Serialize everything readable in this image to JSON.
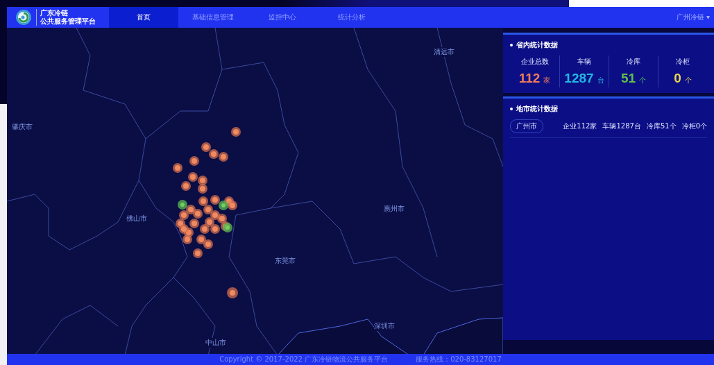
{
  "header": {
    "logo_line_1": "广东冷链",
    "logo_line_2": "公共服务管理平台",
    "nav": [
      {
        "label": "首页",
        "selected": true
      },
      {
        "label": "基础信息管理",
        "selected": false
      },
      {
        "label": "监控中心",
        "selected": false
      },
      {
        "label": "统计分析",
        "selected": false
      }
    ],
    "user": "广州冷链 ▾"
  },
  "map": {
    "labels": [
      "清远市",
      "肇庆市",
      "佛山市",
      "惠州市",
      "东莞市",
      "深圳市",
      "中山市"
    ]
  },
  "province_stats": {
    "title": "省内统计数据",
    "items": [
      {
        "label": "企业总数",
        "value": "112",
        "unit": "家",
        "color": "#f07a5a"
      },
      {
        "label": "车辆",
        "value": "1287",
        "unit": "台",
        "color": "#22b8e0"
      },
      {
        "label": "冷库",
        "value": "51",
        "unit": "个",
        "color": "#5cc04a"
      },
      {
        "label": "冷柜",
        "value": "0",
        "unit": "个",
        "color": "#e8d650"
      }
    ]
  },
  "city_stats": {
    "title": "地市统计数据",
    "rows": [
      {
        "city": "广州市",
        "cells": [
          "企业112家",
          "车辆1287台",
          "冷库51个",
          "冷柜0个"
        ]
      }
    ]
  },
  "footer": {
    "copyright": "Copyright © 2017-2022 广东冷链物流公共服务平台",
    "hotline": "服务热线：020-83127017"
  }
}
